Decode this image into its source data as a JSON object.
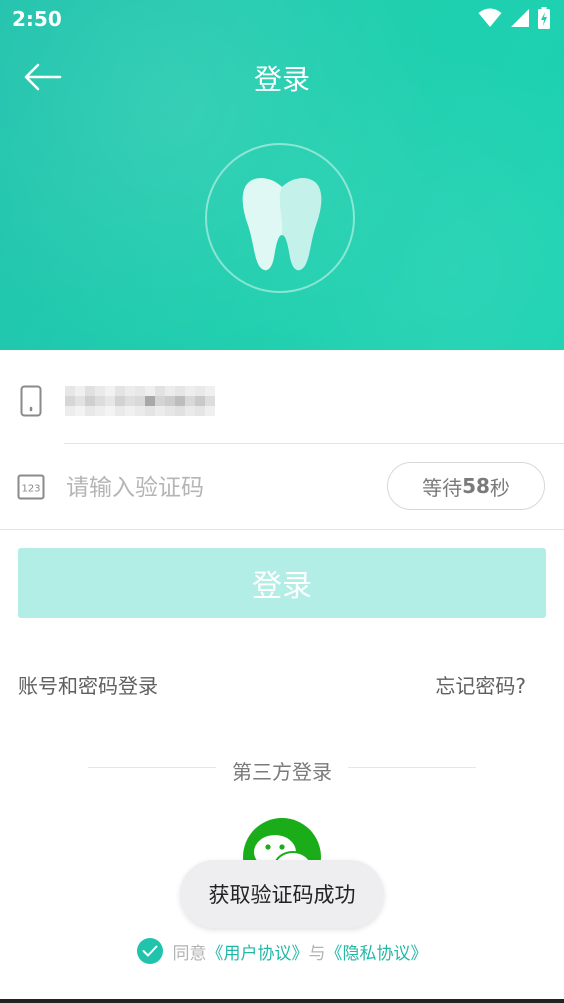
{
  "status_bar": {
    "time": "2:50"
  },
  "nav": {
    "title": "登录"
  },
  "form": {
    "phone_value": "",
    "code_placeholder": "请输入验证码",
    "wait_prefix": "等待",
    "wait_seconds": "58",
    "wait_suffix": "秒",
    "login_label": "登录"
  },
  "links": {
    "account_login": "账号和密码登录",
    "forgot_password": "忘记密码?"
  },
  "third_party": {
    "label": "第三方登录"
  },
  "toast": {
    "message": "获取验证码成功"
  },
  "agreement": {
    "prefix": "同意",
    "user_agreement": "《用户协议》",
    "conjunction": "与",
    "privacy_agreement": "《隐私协议》"
  },
  "colors": {
    "accent": "#1fcfae",
    "button_disabled": "#b2ede6",
    "wechat_green": "#1aad19"
  }
}
